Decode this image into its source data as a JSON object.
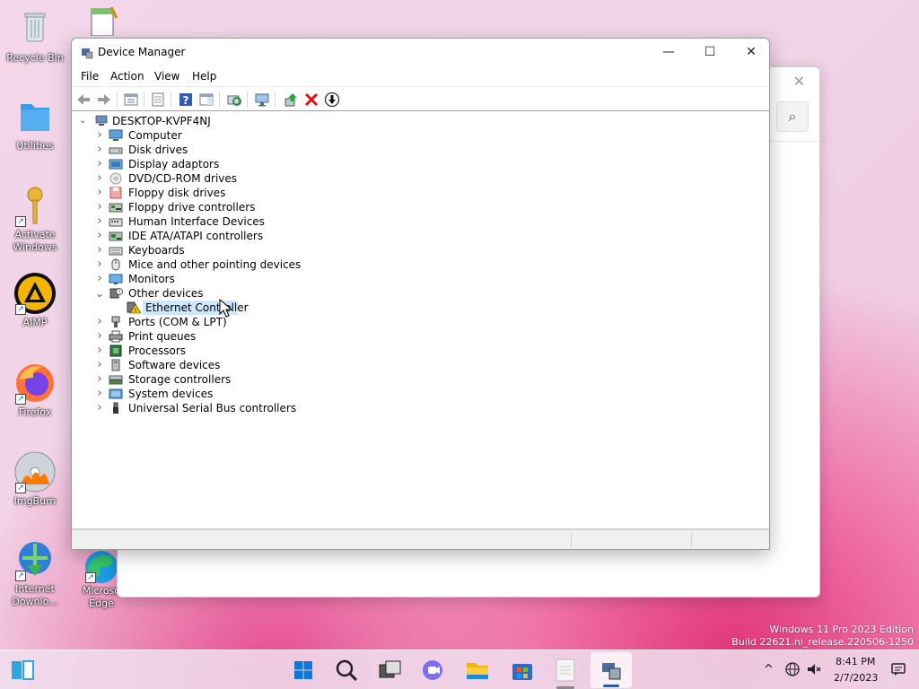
{
  "desktop": {
    "icons": [
      {
        "label": "Recycle Bin"
      },
      {
        "label": "Utilities"
      },
      {
        "label": "Activate Windows"
      },
      {
        "label": "AIMP"
      },
      {
        "label": "Firefox"
      },
      {
        "label": "ImgBurn"
      },
      {
        "label": "Internet Downlo..."
      },
      {
        "label": "Microso Edge"
      }
    ]
  },
  "window": {
    "title": "Device Manager",
    "minimize": "—",
    "maximize": "☐",
    "close": "✕"
  },
  "menu": [
    "File",
    "Action",
    "View",
    "Help"
  ],
  "tree": {
    "root": "DESKTOP-KVPF4NJ",
    "categories": [
      {
        "label": "Computer",
        "icon": "computer-icon"
      },
      {
        "label": "Disk drives",
        "icon": "disk-drive-icon"
      },
      {
        "label": "Display adaptors",
        "icon": "display-adapter-icon"
      },
      {
        "label": "DVD/CD-ROM drives",
        "icon": "dvd-icon"
      },
      {
        "label": "Floppy disk drives",
        "icon": "floppy-disk-icon"
      },
      {
        "label": "Floppy drive controllers",
        "icon": "floppy-controller-icon"
      },
      {
        "label": "Human Interface Devices",
        "icon": "hid-icon"
      },
      {
        "label": "IDE ATA/ATAPI controllers",
        "icon": "ide-controller-icon"
      },
      {
        "label": "Keyboards",
        "icon": "keyboard-icon"
      },
      {
        "label": "Mice and other pointing devices",
        "icon": "mouse-icon"
      },
      {
        "label": "Monitors",
        "icon": "monitor-icon"
      },
      {
        "label": "Other devices",
        "icon": "other-devices-icon",
        "expanded": true
      },
      {
        "label": "Ports (COM & LPT)",
        "icon": "ports-icon"
      },
      {
        "label": "Print queues",
        "icon": "printer-icon"
      },
      {
        "label": "Processors",
        "icon": "processor-icon"
      },
      {
        "label": "Software devices",
        "icon": "software-device-icon"
      },
      {
        "label": "Storage controllers",
        "icon": "storage-controller-icon"
      },
      {
        "label": "System devices",
        "icon": "system-devices-icon"
      },
      {
        "label": "Universal Serial Bus controllers",
        "icon": "usb-icon"
      }
    ],
    "other_devices_child": "Ethernet Controller"
  },
  "watermark": {
    "line1": "Windows 11 Pro 2023 Edition",
    "line2": "Build 22621.ni_release.220506-1250"
  },
  "tray": {
    "time": "8:41 PM",
    "date": "2/7/2023"
  },
  "colors": {
    "accent": "#0067c0",
    "selection": "#cce8ff",
    "warning": "#f5c400"
  }
}
